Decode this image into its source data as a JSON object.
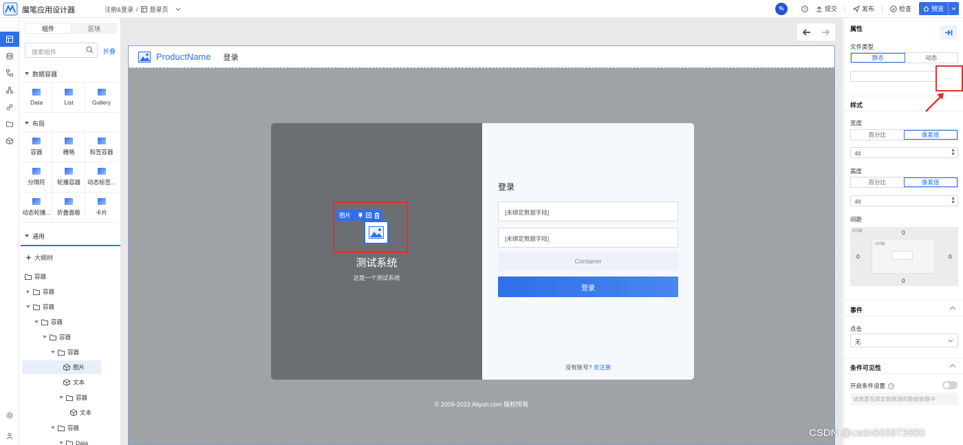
{
  "app": {
    "title": "魔笔应用设计器"
  },
  "breadcrumb": {
    "parent": "注册&登录",
    "sep": "/",
    "page": "登录页"
  },
  "toolbar": {
    "percent": "%",
    "submit": "提交",
    "publish": "发布",
    "check": "检查",
    "preview": "预览"
  },
  "left": {
    "tabs": [
      "组件",
      "区块"
    ],
    "search_placeholder": "搜索组件",
    "collapse": "折叠",
    "sections": {
      "data": "数据容器",
      "layout": "布局",
      "common": "通用"
    },
    "data_items": [
      "Data",
      "List",
      "Gallery"
    ],
    "layout_items": [
      "容器",
      "栅格",
      "标签容器",
      "分隔符",
      "轮播容器",
      "动态标签...",
      "动态轮播...",
      "折叠面板",
      "卡片"
    ],
    "outline_title": "大纲树",
    "tree": [
      "容器",
      "容器",
      "容器",
      "容器",
      "容器",
      "容器",
      "图片",
      "文本",
      "容器",
      "文本",
      "容器",
      "Data"
    ]
  },
  "canvas": {
    "product_name": "ProductName",
    "nav_link": "登录",
    "system_title": "测试系统",
    "system_subtitle": "这是一个测试系统",
    "image_tag": "图片",
    "login_title": "登录",
    "field1": "[未绑定数据字段]",
    "field2": "[未绑定数据字段]",
    "container_placeholder": "Container",
    "login_button": "登录",
    "no_account": "没有账号?",
    "register_link": "去注册",
    "copyright": "© 2009-2023 Aliyun.com 版权所有"
  },
  "right": {
    "properties": "属性",
    "file_type": "文件类型",
    "file_type_options": [
      "静态",
      "动态"
    ],
    "more": "···",
    "style": "样式",
    "width": "宽度",
    "height": "高度",
    "unit_options": [
      "百分比",
      "像素值"
    ],
    "width_value": "48",
    "height_value": "48",
    "spacing": "间距",
    "margin_label": "外间距",
    "padding_label": "内间距",
    "spacing_values": {
      "top": "0",
      "left": "0",
      "right": "0",
      "bottom": "0"
    },
    "events": "事件",
    "click": "点击",
    "click_value": "无",
    "visibility": "条件可见性",
    "enable_condition": "开启条件设置",
    "condition_hint": "请放置在绑定数据源的数据容器中"
  },
  "watermark": "CSDN @csdn565973850",
  "colors": {
    "accent": "#2f6fe8",
    "highlight": "#e03030"
  }
}
